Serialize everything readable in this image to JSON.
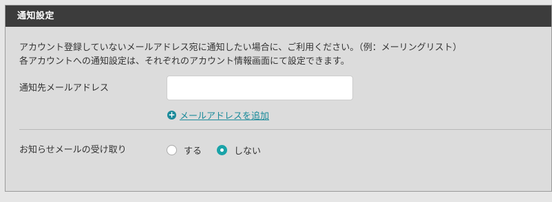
{
  "section": {
    "title": "通知設定"
  },
  "description": {
    "line1": "アカウント登録していないメールアドレス宛に通知したい場合に、ご利用ください。（例：メーリングリスト）",
    "line2": "各アカウントへの通知設定は、それぞれのアカウント情報画面にて設定できます。"
  },
  "email_field": {
    "label": "通知先メールアドレス",
    "value": "",
    "placeholder": ""
  },
  "add_email": {
    "icon": "plus-circle-icon",
    "label": "メールアドレスを追加"
  },
  "receive_notice": {
    "label": "お知らせメールの受け取り",
    "options": [
      {
        "label": "する",
        "checked": false
      },
      {
        "label": "しない",
        "checked": true
      }
    ]
  },
  "colors": {
    "header_bg": "#3c3c3c",
    "accent": "#1aa3a8",
    "link": "#1a8a9a"
  }
}
